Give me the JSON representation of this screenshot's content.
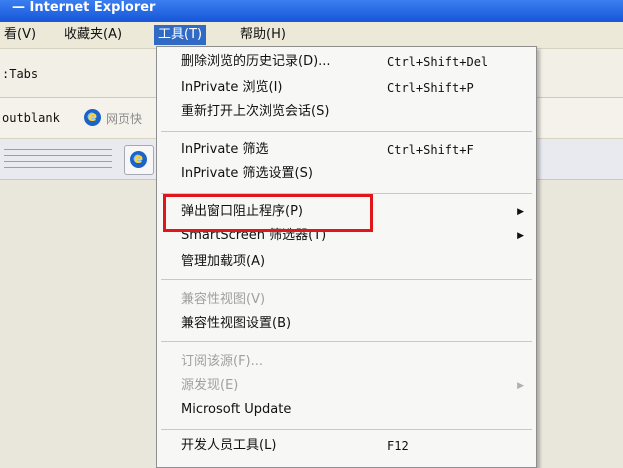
{
  "window": {
    "title": "— Internet Explorer"
  },
  "menubar": {
    "view": "看(V)",
    "favorites": "收藏夹(A)",
    "tools": "工具(T)",
    "help": "帮助(H)"
  },
  "addressbar": {
    "text": ":Tabs"
  },
  "favbar": {
    "text": "outblank",
    "item": "网页快"
  },
  "tools_menu": {
    "items": [
      {
        "label": "删除浏览的历史记录(D)...",
        "shortcut": "Ctrl+Shift+Del"
      },
      {
        "label": "InPrivate 浏览(I)",
        "shortcut": "Ctrl+Shift+P"
      },
      {
        "label": "重新打开上次浏览会话(S)"
      },
      {
        "label": "InPrivate 筛选",
        "shortcut": "Ctrl+Shift+F"
      },
      {
        "label": "InPrivate 筛选设置(S)"
      },
      {
        "label": "弹出窗口阻止程序(P)",
        "has_submenu": true
      },
      {
        "label": "SmartScreen 筛选器(T)",
        "has_submenu": true
      },
      {
        "label": "管理加载项(A)"
      },
      {
        "label": "兼容性视图(V)",
        "disabled": true
      },
      {
        "label": "兼容性视图设置(B)"
      },
      {
        "label": "订阅该源(F)...",
        "disabled": true
      },
      {
        "label": "源发现(E)",
        "disabled": true,
        "has_submenu": true
      },
      {
        "label": "Microsoft Update"
      },
      {
        "label": "开发人员工具(L)",
        "shortcut": "F12"
      }
    ]
  },
  "colors": {
    "highlight_box": "#e0161b",
    "menu_active": "#316ac5",
    "title_bar": "#1656d8",
    "disabled_text": "#a0a0a0"
  },
  "icons": {
    "ie": "internet-explorer-icon",
    "submenu": "triangle-right-icon"
  }
}
